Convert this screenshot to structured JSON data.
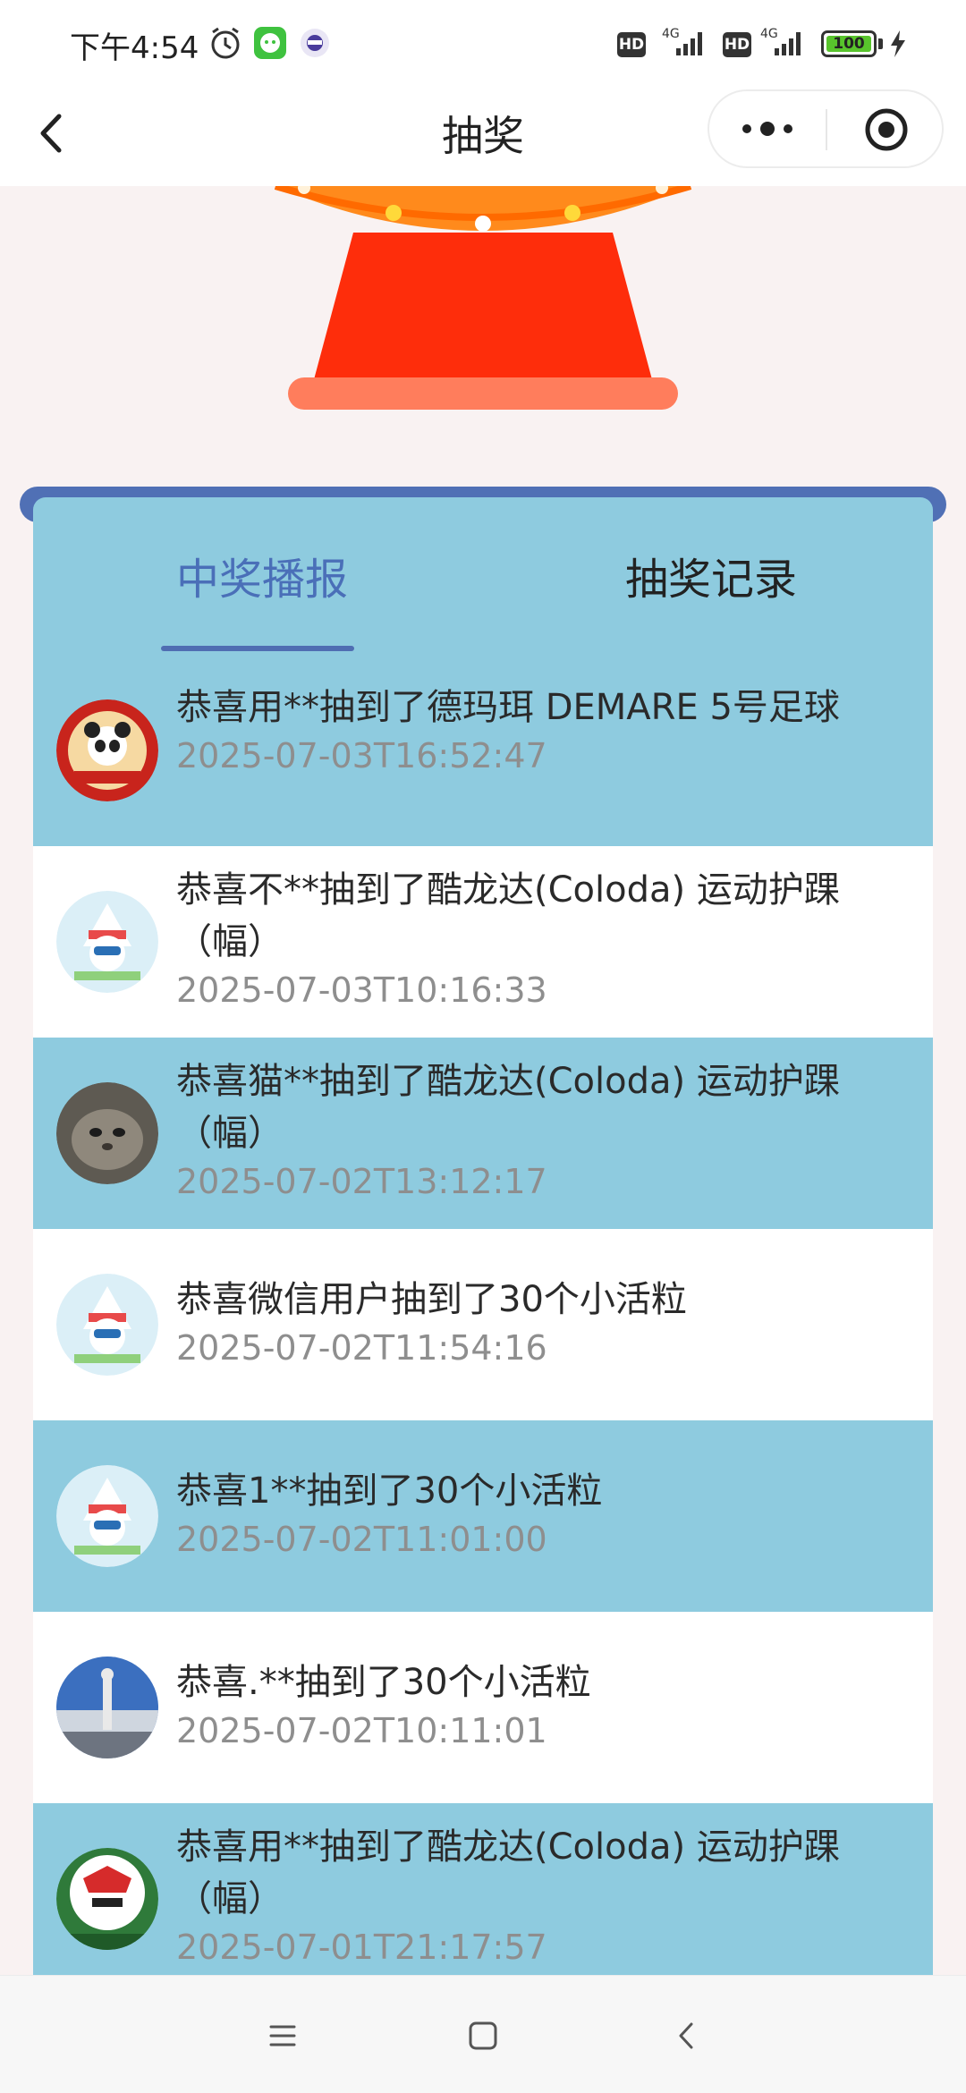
{
  "status_bar": {
    "time": "下午4:54",
    "icons": [
      "alarm-icon",
      "wechat-app-icon",
      "browser-app-icon"
    ],
    "hd_label": "HD",
    "network_label": "4G",
    "battery_level": "100"
  },
  "nav": {
    "title": "抽奖",
    "icons": [
      "back-icon",
      "more-icon",
      "close-miniprogram-icon"
    ]
  },
  "tabs": {
    "active": "中奖播报",
    "inactive": "抽奖记录"
  },
  "colors": {
    "panel_bg": "#8ecbdf",
    "tab_active": "#4a6fb8",
    "rim": "#5070b5",
    "row_alt": "#ffffff",
    "machine_red": "#fe2d0b",
    "machine_base": "#ff7d5c"
  },
  "records": [
    {
      "text": "恭喜用**抽到了德玛珥 DEMARE 5号足球",
      "time": "2025-07-03T16:52:47",
      "avatar": "panda-avatar"
    },
    {
      "text": "恭喜不**抽到了酷龙达(Coloda) 运动护踝（幅）",
      "time": "2025-07-03T10:16:33",
      "avatar": "mascot-avatar"
    },
    {
      "text": "恭喜猫**抽到了酷龙达(Coloda) 运动护踝（幅）",
      "time": "2025-07-02T13:12:17",
      "avatar": "cat-avatar"
    },
    {
      "text": "恭喜微信用户抽到了30个小活粒",
      "time": "2025-07-02T11:54:16",
      "avatar": "mascot-avatar"
    },
    {
      "text": "恭喜1**抽到了30个小活粒",
      "time": "2025-07-02T11:01:00",
      "avatar": "mascot-avatar"
    },
    {
      "text": "恭喜.**抽到了30个小活粒",
      "time": "2025-07-02T10:11:01",
      "avatar": "statue-avatar"
    },
    {
      "text": "恭喜用**抽到了酷龙达(Coloda) 运动护踝（幅）",
      "time": "2025-07-01T21:17:57",
      "avatar": "football-avatar"
    }
  ],
  "system_nav": [
    "menu-icon",
    "home-icon",
    "back-icon"
  ]
}
